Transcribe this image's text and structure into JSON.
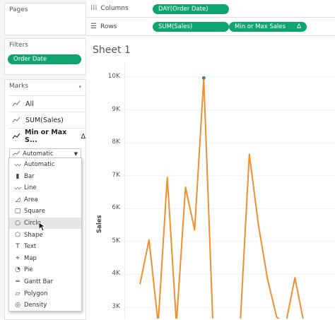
{
  "left": {
    "pages_title": "Pages",
    "filters_title": "Filters",
    "filter_pill": "Order Date",
    "marks_title": "Marks",
    "marks_rows": [
      "All",
      "SUM(Sales)",
      "Min or Max S..."
    ],
    "mark_type_selected": "Automatic",
    "dropdown_options": [
      "Automatic",
      "Bar",
      "Line",
      "Area",
      "Square",
      "Circle",
      "Shape",
      "Text",
      "Map",
      "Pie",
      "Gantt Bar",
      "Polygon",
      "Density"
    ],
    "highlighted_option": "Circle"
  },
  "shelves": {
    "columns_label": "Columns",
    "columns_pill": "DAY(Order Date)",
    "rows_label": "Rows",
    "rows_pills": [
      "SUM(Sales)",
      "Min or Max Sales"
    ],
    "delta_symbol": "Δ"
  },
  "sheet": {
    "title": "Sheet 1"
  },
  "chart_data": {
    "type": "line",
    "ylabel": "Sales",
    "yticks": [
      "10K",
      "9K",
      "8K",
      "7K",
      "6K",
      "5K",
      "4K",
      "3K"
    ],
    "ylim_visible": [
      2700,
      10400
    ],
    "series": [
      {
        "values": [
          3700,
          5050,
          2500,
          6950,
          2500,
          6650,
          5350,
          9950,
          2500,
          2500,
          2500,
          2500,
          7650,
          5500,
          3850,
          2700,
          2500,
          3900,
          2500
        ],
        "color": "#f28e2b"
      }
    ],
    "highlight_point": {
      "index": 7,
      "value": 9950,
      "color": "#4e79a7"
    }
  }
}
